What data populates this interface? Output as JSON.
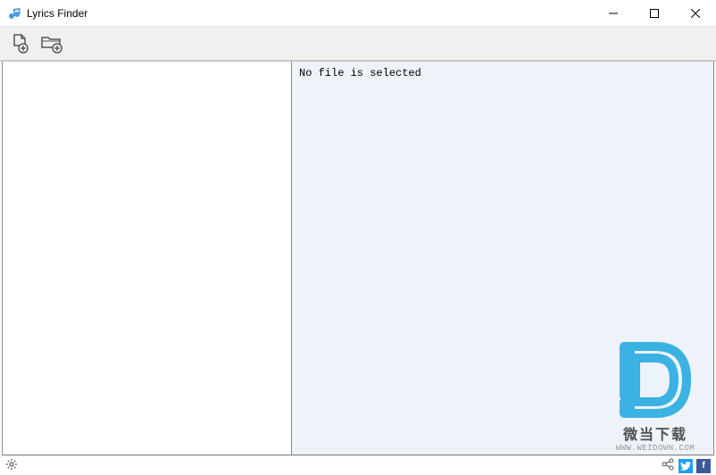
{
  "titlebar": {
    "title": "Lyrics Finder"
  },
  "toolbar": {
    "add_file_label": "Add File",
    "add_folder_label": "Add Folder"
  },
  "main": {
    "empty_message": "No file is selected"
  },
  "watermark": {
    "text1": "微当下载",
    "text2": "WWW.WEIDOWN.COM"
  },
  "statusbar": {
    "twitter": "t",
    "facebook": "f"
  }
}
